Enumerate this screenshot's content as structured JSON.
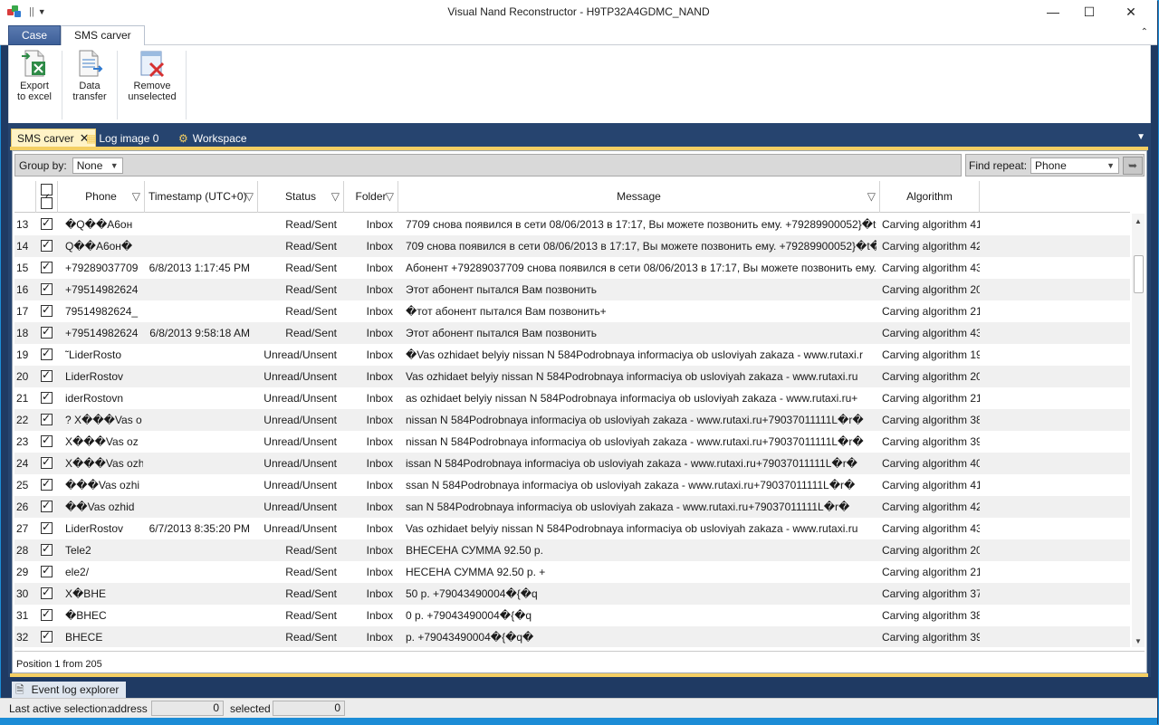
{
  "window": {
    "title": "Visual Nand Reconstructor - H9TP32A4GDMC_NAND",
    "minimize": "—",
    "maximize": "☐",
    "close": "✕"
  },
  "ribbon_tabs": {
    "case": "Case",
    "sms": "SMS carver"
  },
  "ribbon": {
    "export": [
      "Export",
      "to excel"
    ],
    "transfer": [
      "Data",
      "transfer"
    ],
    "remove": [
      "Remove",
      "unselected"
    ]
  },
  "doc_tabs": {
    "sms": "SMS carver",
    "log": "Log image 0",
    "workspace": "Workspace"
  },
  "toolbar": {
    "group_by_label": "Group by:",
    "group_by_value": "None",
    "find_repeat_label": "Find repeat:",
    "find_repeat_value": "Phone"
  },
  "columns": {
    "phone": "Phone",
    "timestamp": "Timestamp (UTC+0)",
    "status": "Status",
    "folder": "Folder",
    "message": "Message",
    "algorithm": "Algorithm"
  },
  "rows": [
    {
      "n": "13",
      "phone": "�Q��A6он",
      "ts": "",
      "status": "Read/Sent",
      "folder": "Inbox",
      "msg": "7709 снова появился в сети 08/06/2013 в 17:17, Вы можете позвонить ему. +79289900052}�t�%",
      "alg": "Carving algorithm 41"
    },
    {
      "n": "14",
      "phone": "Q��A6он�",
      "ts": "",
      "status": "Read/Sent",
      "folder": "Inbox",
      "msg": "709 снова появился в сети 08/06/2013 в 17:17, Вы можете позвонить ему. +79289900052}�t�%",
      "alg": "Carving algorithm 42"
    },
    {
      "n": "15",
      "phone": "+79289037709",
      "ts": "6/8/2013 1:17:45 PM",
      "status": "Read/Sent",
      "folder": "Inbox",
      "msg": "Абонент +79289037709 снова появился в сети 08/06/2013 в 17:17, Вы можете позвонить ему.",
      "alg": "Carving algorithm 43"
    },
    {
      "n": "16",
      "phone": "+79514982624",
      "ts": "",
      "status": "Read/Sent",
      "folder": "Inbox",
      "msg": "Этот абонент пытался Вам позвонить",
      "alg": "Carving algorithm 20"
    },
    {
      "n": "17",
      "phone": "79514982624_",
      "ts": "",
      "status": "Read/Sent",
      "folder": "Inbox",
      "msg": "�тот абонент пытался Вам позвонить+",
      "alg": "Carving algorithm 21"
    },
    {
      "n": "18",
      "phone": "+79514982624",
      "ts": "6/8/2013 9:58:18 AM",
      "status": "Read/Sent",
      "folder": "Inbox",
      "msg": "Этот абонент пытался Вам позвонить",
      "alg": "Carving algorithm 43"
    },
    {
      "n": "19",
      "phone": "˜LiderRosto",
      "ts": "",
      "status": "Unread/Unsent",
      "folder": "Inbox",
      "msg": "�Vas ozhidaet belyiy nissan N 584Podrobnaya informaciya ob usloviyah zakaza - www.rutaxi.r",
      "alg": "Carving algorithm 19"
    },
    {
      "n": "20",
      "phone": "LiderRostov",
      "ts": "",
      "status": "Unread/Unsent",
      "folder": "Inbox",
      "msg": "Vas ozhidaet belyiy nissan N 584Podrobnaya informaciya ob usloviyah zakaza - www.rutaxi.ru",
      "alg": "Carving algorithm 20"
    },
    {
      "n": "21",
      "phone": "iderRostovn",
      "ts": "",
      "status": "Unread/Unsent",
      "folder": "Inbox",
      "msg": "as ozhidaet belyiy nissan N 584Podrobnaya informaciya ob usloviyah zakaza - www.rutaxi.ru+",
      "alg": "Carving algorithm 21"
    },
    {
      "n": "22",
      "phone": "? X���Vas o",
      "ts": "",
      "status": "Unread/Unsent",
      "folder": "Inbox",
      "msg": " nissan N 584Podrobnaya informaciya ob usloviyah zakaza - www.rutaxi.ru+79037011111L�r�",
      "alg": "Carving algorithm 38"
    },
    {
      "n": "23",
      "phone": " X���Vas oz",
      "ts": "",
      "status": "Unread/Unsent",
      "folder": "Inbox",
      "msg": "nissan N 584Podrobnaya informaciya ob usloviyah zakaza - www.rutaxi.ru+79037011111L�r�",
      "alg": "Carving algorithm 39"
    },
    {
      "n": "24",
      "phone": "X���Vas ozh",
      "ts": "",
      "status": "Unread/Unsent",
      "folder": "Inbox",
      "msg": "issan N 584Podrobnaya informaciya ob usloviyah zakaza - www.rutaxi.ru+79037011111L�r�",
      "alg": "Carving algorithm 40"
    },
    {
      "n": "25",
      "phone": "���Vas ozhi",
      "ts": "",
      "status": "Unread/Unsent",
      "folder": "Inbox",
      "msg": "ssan N 584Podrobnaya informaciya ob usloviyah zakaza - www.rutaxi.ru+79037011111L�r�",
      "alg": "Carving algorithm 41"
    },
    {
      "n": "26",
      "phone": "��Vas ozhid",
      "ts": "",
      "status": "Unread/Unsent",
      "folder": "Inbox",
      "msg": "san N 584Podrobnaya informaciya ob usloviyah zakaza - www.rutaxi.ru+79037011111L�r�",
      "alg": "Carving algorithm 42"
    },
    {
      "n": "27",
      "phone": "LiderRostov",
      "ts": "6/7/2013 8:35:20 PM",
      "status": "Unread/Unsent",
      "folder": "Inbox",
      "msg": "Vas ozhidaet belyiy nissan N 584Podrobnaya informaciya ob usloviyah zakaza - www.rutaxi.ru",
      "alg": "Carving algorithm 43"
    },
    {
      "n": "28",
      "phone": "Tele2",
      "ts": "",
      "status": "Read/Sent",
      "folder": "Inbox",
      "msg": "ВНЕСЕНА СУММА 92.50 р.",
      "alg": "Carving algorithm 20"
    },
    {
      "n": "29",
      "phone": "ele2/",
      "ts": "",
      "status": "Read/Sent",
      "folder": "Inbox",
      "msg": "НЕСЕНА СУММА 92.50 р. +",
      "alg": "Carving algorithm 21"
    },
    {
      "n": "30",
      "phone": "X�ВНЕ",
      "ts": "",
      "status": "Read/Sent",
      "folder": "Inbox",
      "msg": "50 р. +79043490004�{�q",
      "alg": "Carving algorithm 37"
    },
    {
      "n": "31",
      "phone": "�ВНЕС",
      "ts": "",
      "status": "Read/Sent",
      "folder": "Inbox",
      "msg": "0 р. +79043490004�{�q",
      "alg": "Carving algorithm 38"
    },
    {
      "n": "32",
      "phone": "ВНЕСЕ",
      "ts": "",
      "status": "Read/Sent",
      "folder": "Inbox",
      "msg": " р. +79043490004�{�q�",
      "alg": "Carving algorithm 39"
    }
  ],
  "position_text": "Position 1 from 205",
  "event_log_tab": "Event log explorer",
  "status": {
    "label": "Last active selection:",
    "address_label": "address",
    "address_value": "0",
    "selected_label": "selected",
    "selected_value": "0"
  },
  "colors": {
    "accent": "#1c8cd6",
    "dark_panel": "#26446f",
    "tab_gold": "#f4cf63"
  }
}
